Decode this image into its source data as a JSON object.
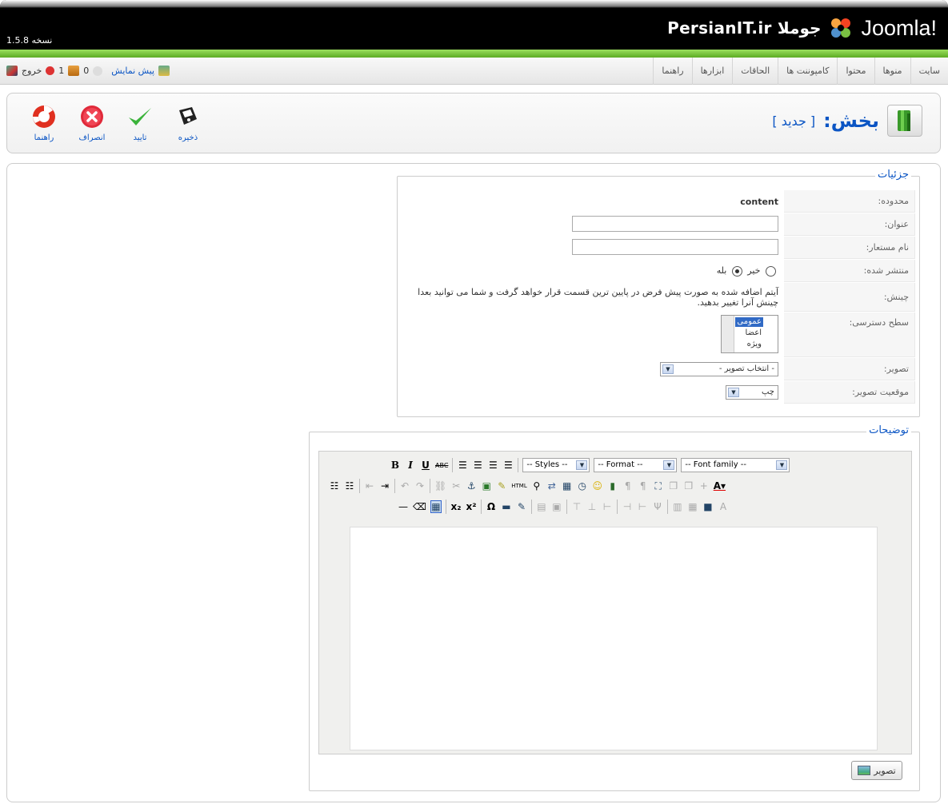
{
  "header": {
    "version": "نسخه 1.5.8",
    "brand_title": "PersianIT.ir جوملا",
    "logo_word": "Joomla!"
  },
  "menu": {
    "items": [
      "سایت",
      "منوها",
      "محتوا",
      "کامپوننت ها",
      "الحاقات",
      "ابزارها",
      "راهنما"
    ]
  },
  "status": {
    "preview": "پیش نمایش",
    "messages": "0",
    "users": "1",
    "logout": "خروج"
  },
  "toolbar": {
    "save": "ذخیره",
    "apply": "تایید",
    "cancel": "انصراف",
    "help": "راهنما",
    "title": "بخش:",
    "subtitle": "[ جدید ]"
  },
  "details": {
    "legend": "جزئیات",
    "scope_label": "محدوده:",
    "scope_value": "content",
    "title_label": "عنوان:",
    "title_value": "",
    "alias_label": "نام مستعار:",
    "alias_value": "",
    "published_label": "منتشر شده:",
    "published_no": "خیر",
    "published_yes": "بله",
    "published_selected": "بله",
    "order_label": "چینش:",
    "order_text": "آیتم اضافه شده به صورت پیش فرض در پایین ترین قسمت قرار خواهد گرفت و شما می توانید بعدا چینش آنرا تغییر بدهید.",
    "access_label": "سطح دسترسی:",
    "access_options": [
      "عمومی",
      "اعضا",
      "ویژه"
    ],
    "access_selected": "عمومی",
    "image_label": "تصویر:",
    "image_value": "- انتخاب تصویر -",
    "image_pos_label": "موقعیت تصویر:",
    "image_pos_value": "چپ"
  },
  "description": {
    "legend": "توضیحات",
    "styles": "-- Styles --",
    "format": "-- Format --",
    "font_family": "-- Font family --",
    "image_button": "تصویر"
  },
  "colors": {
    "brand_blue": "#0b55c4",
    "green_bar": "#5cab24"
  }
}
